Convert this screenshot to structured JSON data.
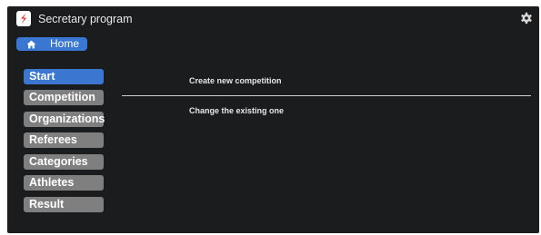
{
  "app": {
    "title": "Secretary program",
    "logo_icon": "app-logo-icon",
    "settings_icon": "gear-icon"
  },
  "home_button": {
    "label": "Home",
    "icon": "home-icon"
  },
  "sidebar": {
    "items": [
      {
        "label": "Start",
        "active": true
      },
      {
        "label": "Competition",
        "active": false
      },
      {
        "label": "Organizations",
        "active": false
      },
      {
        "label": "Referees",
        "active": false
      },
      {
        "label": "Categories",
        "active": false
      },
      {
        "label": "Athletes",
        "active": false
      },
      {
        "label": "Result",
        "active": false
      }
    ]
  },
  "main": {
    "options": [
      {
        "label": "Create new competition"
      },
      {
        "label": "Change the existing one"
      }
    ]
  },
  "colors": {
    "background": "#1b1c1e",
    "accent": "#3b77d0",
    "nav_inactive": "#7f7f80",
    "logo_red": "#e0312a"
  }
}
